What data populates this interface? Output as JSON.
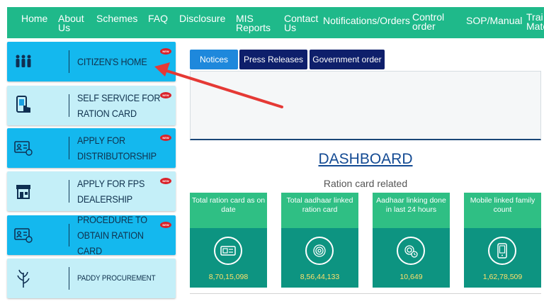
{
  "nav": {
    "items": [
      {
        "label": "Home"
      },
      {
        "label": "About\nUs"
      },
      {
        "label": "Schemes"
      },
      {
        "label": "FAQ"
      },
      {
        "label": "Disclosure"
      },
      {
        "label": "MIS\nReports"
      },
      {
        "label": "Contact\nUs"
      },
      {
        "label": "Notifications/Orders"
      },
      {
        "label": "Control\norder"
      },
      {
        "label": "SOP/Manual"
      },
      {
        "label": "Trai\nMate"
      }
    ]
  },
  "sidebar": {
    "items": [
      {
        "label": "CITIZEN'S HOME",
        "icon": "people-icon",
        "badge": "NEW"
      },
      {
        "label": "SELF SERVICE FOR RATION CARD",
        "icon": "phone-touch-icon",
        "badge": "NEW"
      },
      {
        "label": "APPLY FOR DISTRIBUTORSHIP",
        "icon": "id-card-icon",
        "badge": "NEW"
      },
      {
        "label": "APPLY FOR FPS DEALERSHIP",
        "icon": "shop-icon",
        "badge": "NEW"
      },
      {
        "label": "PROCEDURE TO OBTAIN RATION CARD",
        "icon": "id-card-icon",
        "badge": "NEW"
      },
      {
        "label": "PADDY PROCUREMENT",
        "icon": "paddy-icon"
      }
    ]
  },
  "tabs": [
    {
      "label": "Notices"
    },
    {
      "label": "Press Releases"
    },
    {
      "label": "Government order"
    }
  ],
  "dashboard": {
    "title": "DASHBOARD",
    "subtitle": "Ration card related",
    "cards": [
      {
        "label": "Total ration card as on date",
        "value": "8,70,15,098",
        "icon": "ration-card-icon"
      },
      {
        "label": "Total aadhaar linked ration card",
        "value": "8,56,44,133",
        "icon": "fingerprint-icon"
      },
      {
        "label": "Aadhaar linking done in last 24 hours",
        "value": "10,649",
        "icon": "fingerprint-clock-icon"
      },
      {
        "label": "Mobile linked family count",
        "value": "1,62,78,509",
        "icon": "mobile-icon"
      }
    ]
  },
  "colors": {
    "nav_bg": "#1fb98a",
    "card_blue": "#14b8ee",
    "card_pale": "#c4eff8",
    "tab_active": "#1e88dc",
    "tab_dark": "#0e1f6b",
    "stat_head": "#2fbf84",
    "stat_body": "#0d9481",
    "stat_value": "#ffe06a",
    "arrow": "#e53935"
  }
}
